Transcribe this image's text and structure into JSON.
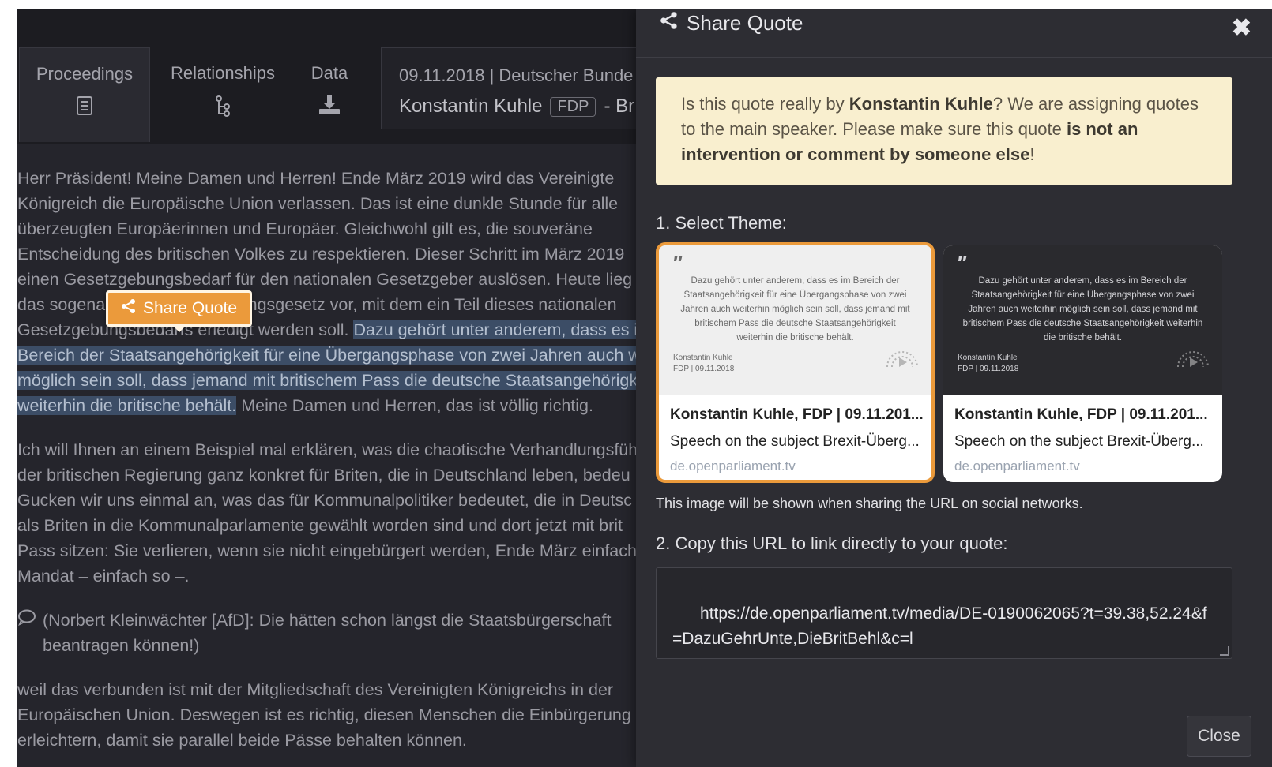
{
  "tabs": [
    {
      "label": "Proceedings",
      "icon": "document-list-icon"
    },
    {
      "label": "Relationships",
      "icon": "hierarchy-icon"
    },
    {
      "label": "Data",
      "icon": "download-icon"
    }
  ],
  "info": {
    "date_line": "09.11.2018 | Deutscher Bunde",
    "speaker": "Konstantin Kuhle",
    "party": "FDP",
    "speaker_suffix": "- Br"
  },
  "transcript": {
    "lines": [
      "Herr Präsident!  Meine Damen und Herren!  Ende März 2019 wird das Vereinigte",
      "Königreich die Europäische Union verlassen.  Das ist eine dunkle Stunde für alle",
      "überzeugten Europäerinnen und Europäer.  Gleichwohl gilt es, die souveräne",
      "Entscheidung des britischen Volkes zu respektieren.  Dieser Schritt im März 2019",
      "einen Gesetzgebungsbedarf für den nationalen Gesetzgeber auslösen.  Heute lieg",
      "das sogenannte Brexit-Übergangsgesetz vor, mit dem ein Teil dieses nationalen"
    ],
    "line7_plain": "Gesetzgebungsbedarfs erledigt werden soll. ",
    "line7_hl": "Dazu gehört unter anderem, dass es im",
    "hl_line8": "Bereich der Staatsangehörigkeit für eine Übergangsphase von zwei Jahren auch w",
    "hl_line9": "möglich sein soll, dass jemand mit britischem Pass die deutsche Staatsangehörigk",
    "hl_line10": "weiterhin die britische behält.",
    "line10_plain": " Meine Damen und Herren, das ist völlig richtig.",
    "para2": [
      "Ich will Ihnen an einem Beispiel mal erklären, was die chaotische Verhandlungsfüh",
      "der britischen Regierung ganz konkret für Briten, die in Deutschland leben, bedeu",
      "Gucken wir uns einmal an, was das für Kommunalpolitiker bedeutet, die in Deutsc",
      "als Briten in die Kommunalparlamente gewählt worden sind und dort jetzt mit brit",
      "Pass sitzen: Sie verlieren, wenn sie nicht eingebürgert werden, Ende März einfach",
      "Mandat – einfach so –."
    ],
    "comment": "(Norbert Kleinwächter [AfD]: Die hätten schon längst die Staatsbürgerschaft beantragen können!)",
    "para3": [
      "weil das verbunden ist mit der Mitgliedschaft des Vereinigten Königreichs in der",
      "Europäischen Union.  Deswegen ist es richtig, diesen Menschen die Einbürgerung",
      "erleichtern, damit sie parallel beide Pässe behalten können."
    ]
  },
  "floating_share_label": "Share Quote",
  "modal": {
    "title": "Share Quote",
    "close_glyph": "✖",
    "warning": {
      "pre": "Is this quote really by ",
      "name": "Konstantin Kuhle",
      "mid": "? We are assigning quotes to the main speaker. Please make sure this quote ",
      "bold": "is not an intervention or comment by someone else",
      "end": "!"
    },
    "step1": "1. Select Theme:",
    "themes": [
      {
        "style": "light",
        "quote_text": "Dazu gehört unter anderem, dass es im Bereich der Staatsangehörigkeit für eine Übergangsphase von zwei Jahren auch weiterhin möglich sein soll, dass jemand mit britischem Pass die deutsche Staatsangehörigkeit weiterhin die britische behält.",
        "footer_name": "Konstantin Kuhle",
        "footer_meta": "FDP | 09.11.2018",
        "card_title": "Konstantin Kuhle, FDP | 09.11.201...",
        "card_sub": "Speech on the subject Brexit-Überg...",
        "card_domain": "de.openparliament.tv"
      },
      {
        "style": "dark",
        "quote_text": "Dazu gehört unter anderem, dass es im Bereich der Staatsangehörigkeit für eine Übergangsphase von zwei Jahren auch weiterhin möglich sein soll, dass jemand mit britischem Pass die deutsche Staatsangehörigkeit weiterhin die britische behält.",
        "footer_name": "Konstantin Kuhle",
        "footer_meta": "FDP | 09.11.2018",
        "card_title": "Konstantin Kuhle, FDP | 09.11.201...",
        "card_sub": "Speech on the subject Brexit-Überg...",
        "card_domain": "de.openparliament.tv"
      }
    ],
    "selected_theme": 0,
    "theme_note": "This image will be shown when sharing the URL on social networks.",
    "step2": "2. Copy this URL to link directly to your quote:",
    "url": "https://de.openparliament.tv/media/DE-0190062065?t=39.38,52.24&f=DazuGehrUnte,DieBritBehl&c=l",
    "close_label": "Close"
  },
  "colors": {
    "accent": "#eb9a3b",
    "highlight": "#3c4d66",
    "warning_bg": "#f9efcf"
  }
}
